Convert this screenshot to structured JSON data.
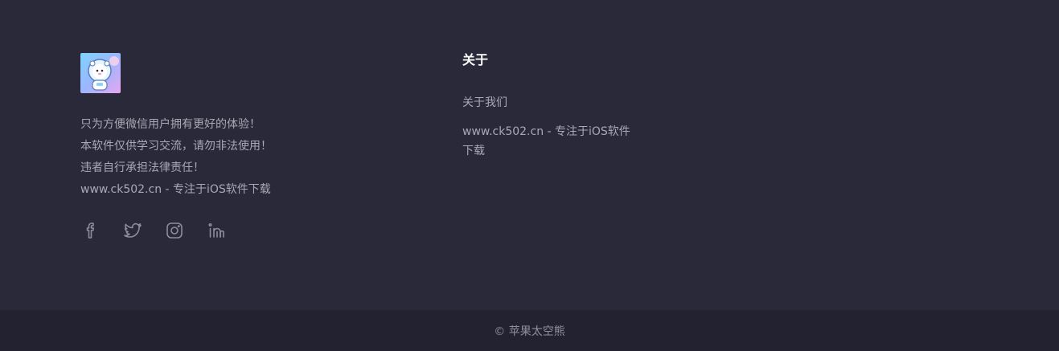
{
  "brand": {
    "logo_icon": "astronaut-bear-logo",
    "description_lines": [
      "只为方便微信用户拥有更好的体验！",
      "本软件仅供学习交流，请勿非法使用！",
      "违者自行承担法律责任！",
      "www.ck502.cn - 专注于iOS软件下载"
    ],
    "social": [
      {
        "name": "facebook-icon"
      },
      {
        "name": "twitter-icon"
      },
      {
        "name": "instagram-icon"
      },
      {
        "name": "linkedin-icon"
      }
    ]
  },
  "about": {
    "title": "关于",
    "links": [
      "关于我们",
      "www.ck502.cn - 专注于iOS软件下载"
    ]
  },
  "footer": {
    "copyright": "© 苹果太空熊"
  },
  "colors": {
    "background": "#2a2939",
    "bottom_bar": "#232230",
    "text": "#a9a8b4",
    "heading": "#ffffff"
  }
}
